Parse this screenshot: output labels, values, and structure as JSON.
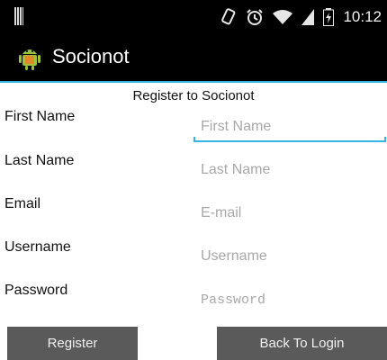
{
  "status_bar": {
    "time": "10:12",
    "icons": [
      "signal-bars-icon",
      "rotate-icon",
      "alarm-icon",
      "wifi-icon",
      "cell-signal-icon",
      "battery-icon"
    ]
  },
  "action_bar": {
    "title": "Socionot",
    "icon": "android-icon",
    "accent_color": "#33b5e5"
  },
  "form": {
    "title": "Register to  Socionot",
    "fields": [
      {
        "label": "First Name",
        "placeholder": "First Name",
        "value": ""
      },
      {
        "label": "Last Name",
        "placeholder": "Last Name",
        "value": ""
      },
      {
        "label": "Email",
        "placeholder": "E-mail",
        "value": ""
      },
      {
        "label": "Username",
        "placeholder": "Username",
        "value": ""
      },
      {
        "label": "Password",
        "placeholder": "Password",
        "value": ""
      }
    ]
  },
  "buttons": {
    "register": "Register",
    "back_to_login": "Back To Login"
  }
}
